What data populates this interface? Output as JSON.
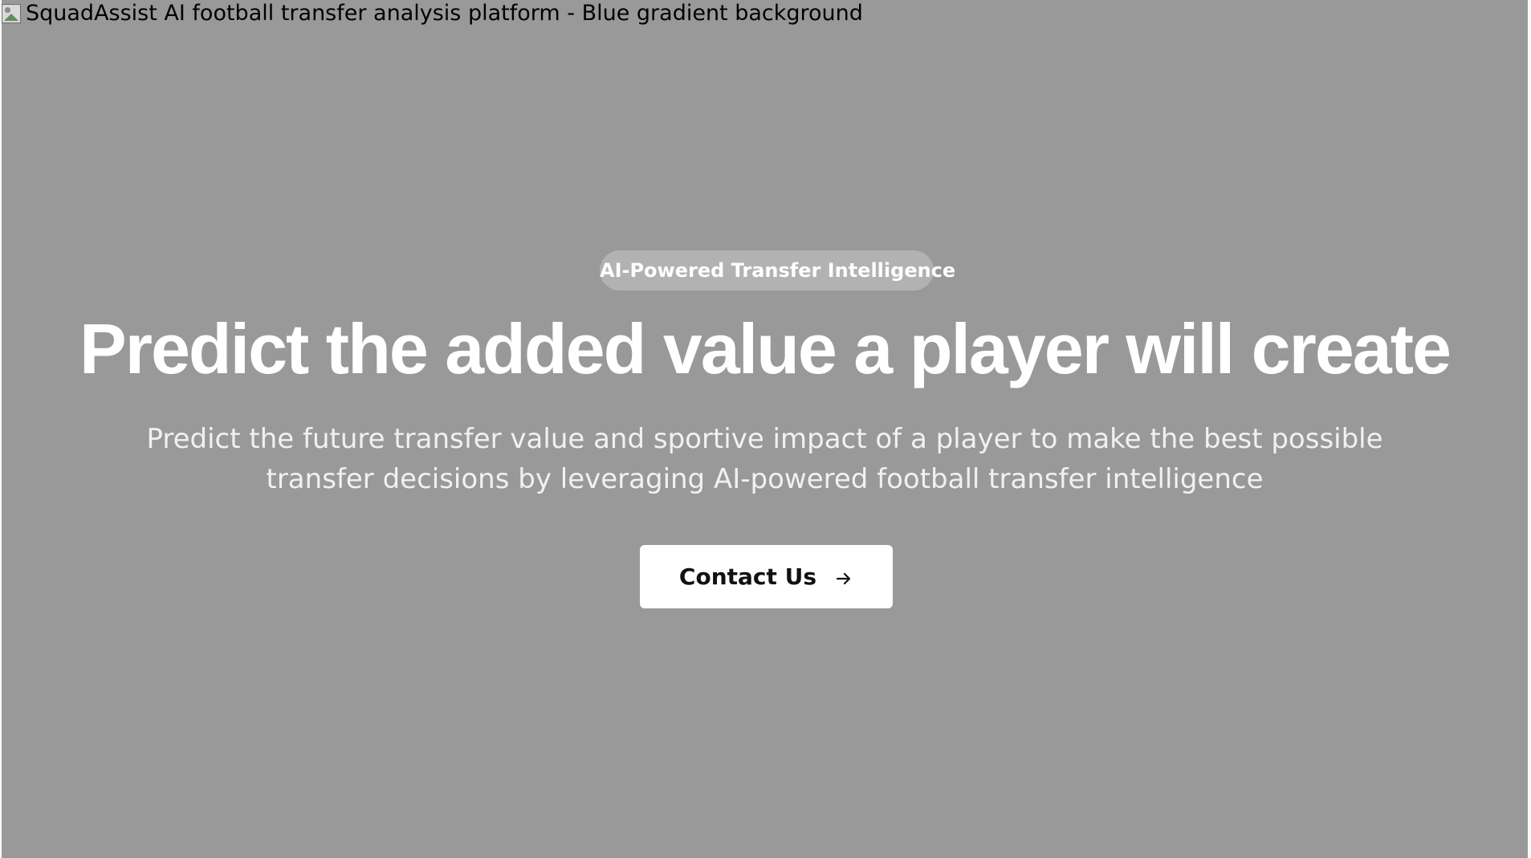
{
  "hero": {
    "image_alt": "SquadAssist AI football transfer analysis platform - Blue gradient background",
    "badge_label": "AI-Powered Transfer Intelligence",
    "headline": "Predict the added value a player will create",
    "subtitle": "Predict the future transfer value and sportive impact of a player to make the best possible transfer decisions by leveraging AI-powered football transfer intelligence",
    "cta_label": "Contact Us",
    "cta_icon": "arrow-right-icon",
    "background_color": "#999999"
  }
}
